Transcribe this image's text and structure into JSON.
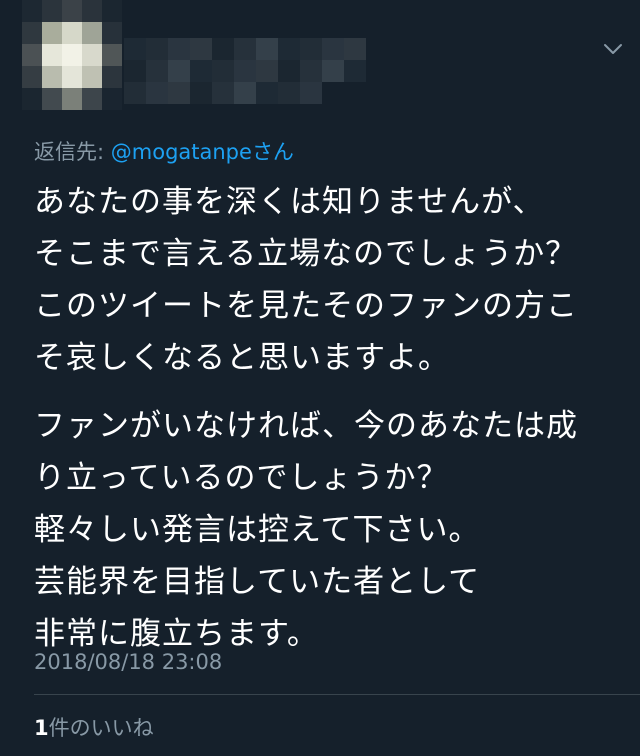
{
  "tweet": {
    "reply_prefix": "返信先: ",
    "reply_handle": "@mogatanpe",
    "reply_suffix": "さん",
    "paragraphs": [
      [
        "あなたの事を深くは知りませんが、",
        "そこまで言える立場なのでしょうか？",
        "このツイートを見たそのファンの方こ",
        "そ哀しくなると思いますよ。"
      ],
      [
        "ファンがいなければ、今のあなたは成",
        "り立っているのでしょうか？",
        "軽々しい発言は控えて下さい。",
        "芸能界を目指していた者として",
        "非常に腹立ちます。"
      ]
    ],
    "timestamp": "2018/08/18 23:08",
    "likes_count": "1",
    "likes_label": "件のいいね"
  },
  "icons": {
    "menu": "chevron-down-icon"
  },
  "colors": {
    "background": "#15202b",
    "text": "#ffffff",
    "secondary": "#8899a6",
    "link": "#1da1f2"
  }
}
